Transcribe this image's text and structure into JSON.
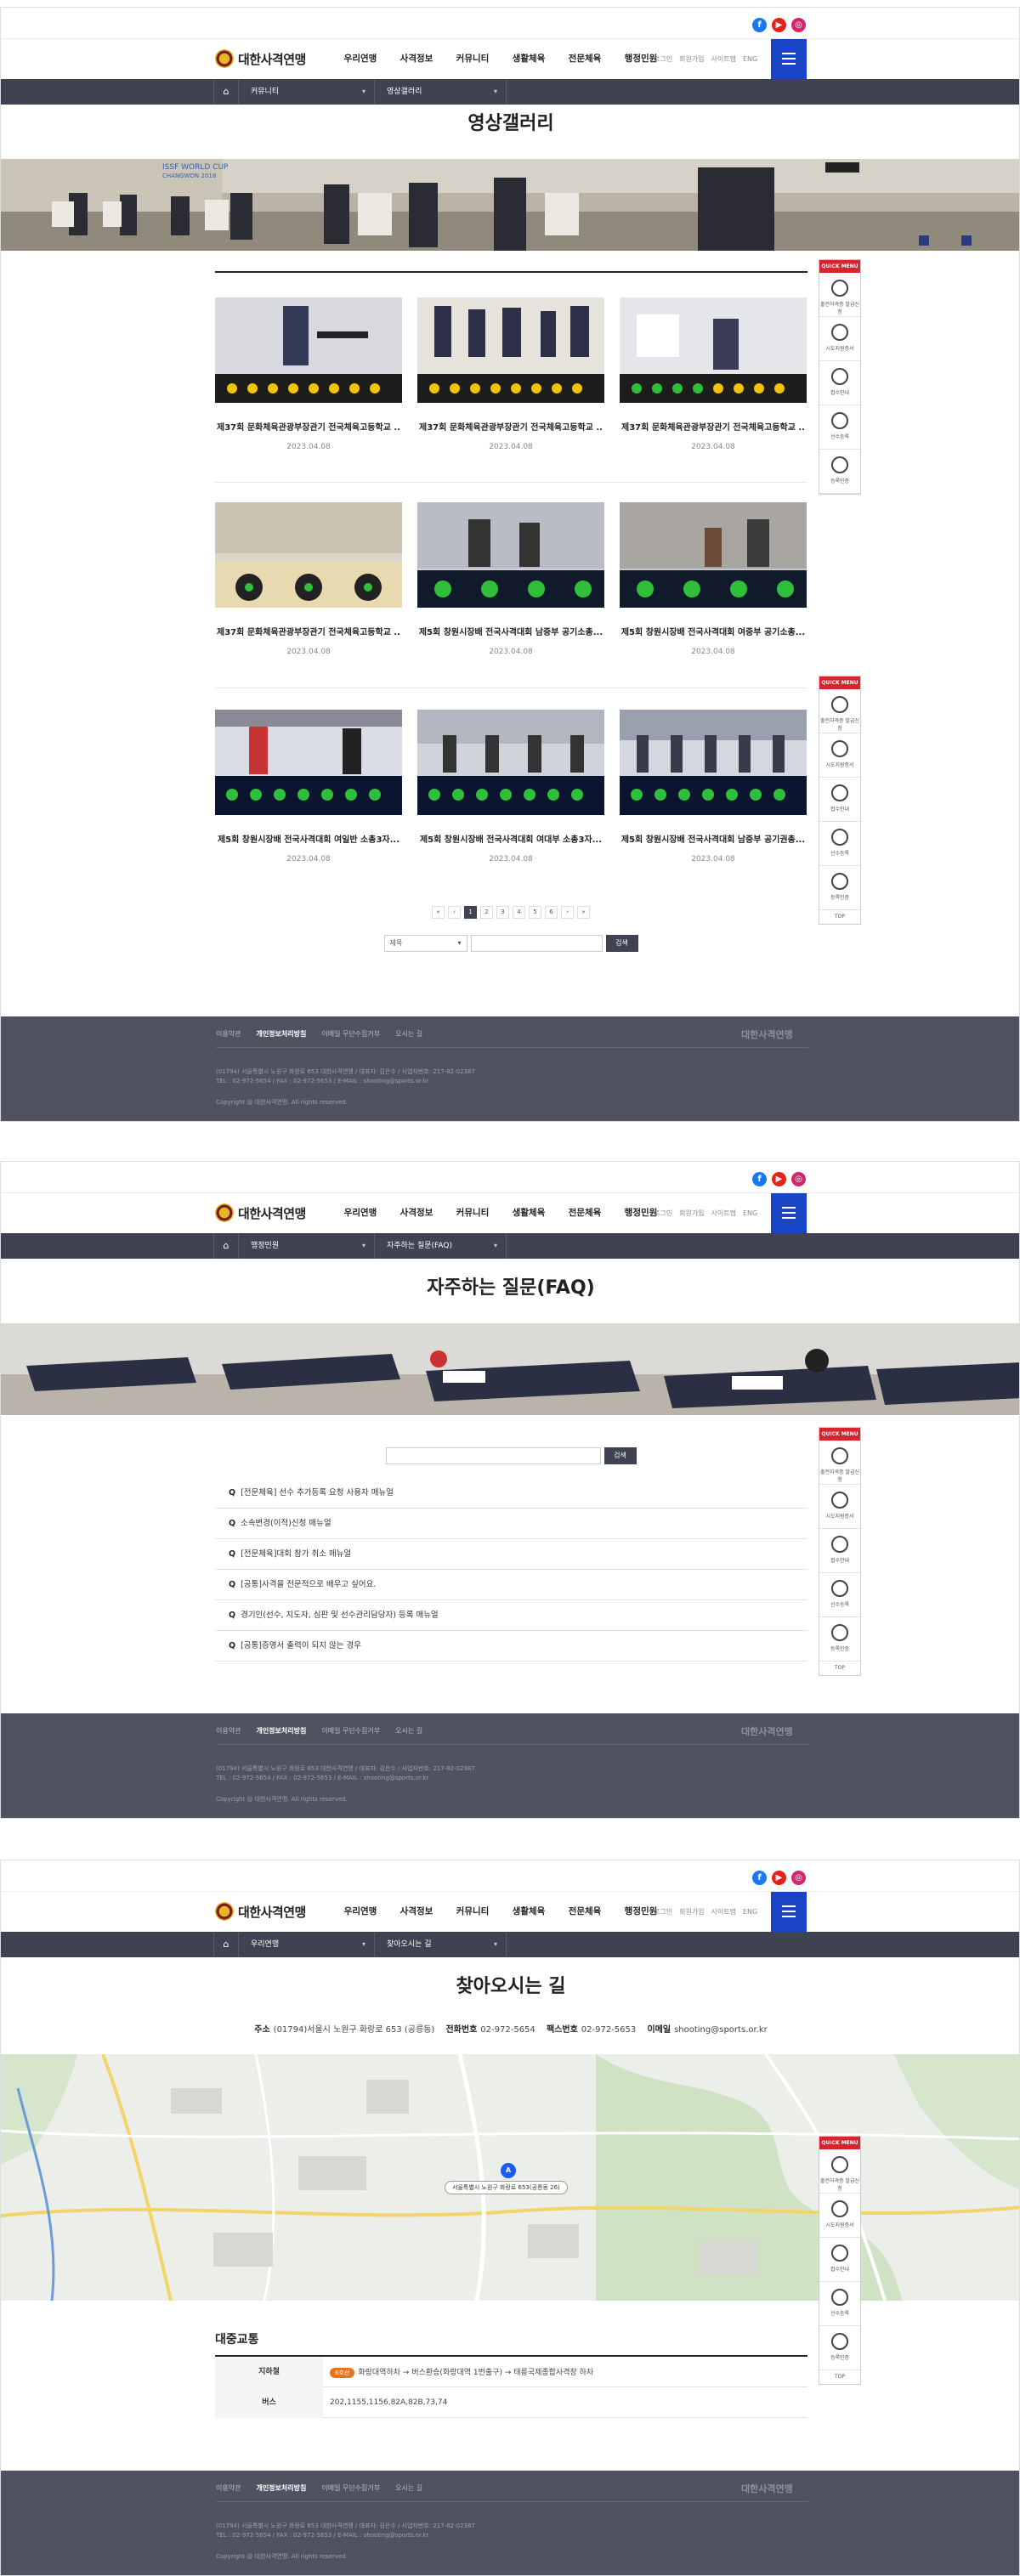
{
  "header": {
    "logo_text": "대한사격연맹",
    "sns": [
      "facebook-icon",
      "youtube-icon",
      "instagram-icon"
    ],
    "menu": [
      "우리연맹",
      "사격정보",
      "커뮤니티",
      "생활체육",
      "전문체육",
      "행정민원"
    ],
    "util": [
      "로그인",
      "회원가입",
      "사이트맵",
      "ENG"
    ]
  },
  "quick_menu": {
    "header": "QUICK MENU",
    "items": [
      "출전자격증 발급신청",
      "시도지원증서",
      "접수안내",
      "선수등록",
      "등록인증"
    ],
    "top": "TOP"
  },
  "gallery_page": {
    "lnb_depth1": "커뮤니티",
    "lnb_depth2": "영상갤러리",
    "title": "영상갤러리",
    "items": [
      {
        "title": "제37회 문화체육관광부장관기 전국체육고등학교 ..",
        "date": "2023.04.08"
      },
      {
        "title": "제37회 문화체육관광부장관기 전국체육고등학교 ..",
        "date": "2023.04.08"
      },
      {
        "title": "제37회 문화체육관광부장관기 전국체육고등학교 ..",
        "date": "2023.04.08"
      },
      {
        "title": "제37회 문화체육관광부장관기 전국체육고등학교 ..",
        "date": "2023.04.08"
      },
      {
        "title": "제5회 창원시장배 전국사격대회 남중부 공기소총...",
        "date": "2023.04.08"
      },
      {
        "title": "제5회 창원시장배 전국사격대회 여중부 공기소총...",
        "date": "2023.04.08"
      },
      {
        "title": "제5회 창원시장배 전국사격대회 여일반 소총3자...",
        "date": "2023.04.08"
      },
      {
        "title": "제5회 창원시장배 전국사격대회 여대부 소총3자...",
        "date": "2023.04.08"
      },
      {
        "title": "제5회 창원시장배 전국사격대회 남중부 공기권총...",
        "date": "2023.04.08"
      }
    ],
    "pager": [
      "«",
      "‹",
      "1",
      "2",
      "3",
      "4",
      "5",
      "6",
      "›",
      "»"
    ],
    "search_select": "제목",
    "search_button": "검색"
  },
  "faq_page": {
    "lnb_depth1": "행정민원",
    "lnb_depth2": "자주하는 질문(FAQ)",
    "title": "자주하는 질문(FAQ)",
    "search_button": "검색",
    "q_mark": "Q",
    "questions": [
      "[전문체육] 선수 추가등록 요청 사용자 매뉴얼",
      "소속변경(이적)신청 매뉴얼",
      "[전문체육]대회 참가 취소 매뉴얼",
      "[공통]사격을 전문적으로 배우고 싶어요.",
      "경기인(선수, 지도자, 심판 및 선수관리담당자) 등록 매뉴얼",
      "[공통]증명서 출력이 되지 않는 경우"
    ]
  },
  "location_page": {
    "lnb_depth1": "우리연맹",
    "lnb_depth2": "찾아오시는 길",
    "title": "찾아오시는 길",
    "address_label": "주소",
    "address": "(01794)서울시 노원구 화랑로 653 (공릉동)",
    "phone_label": "전화번호",
    "phone": "02-972-5654",
    "fax_label": "팩스번호",
    "fax": "02-972-5653",
    "email_label": "이메일",
    "email": "shooting@sports.or.kr",
    "map_pin": "A",
    "map_label": "서울특별시 노원구 화랑로 653(공릉동 26)",
    "transport_title": "대중교통",
    "rows": [
      {
        "label": "지하철",
        "badge": "6호선",
        "text": "화랑대역하차 → 버스환승(화랑대역 1번출구) → 태릉국제종합사격장 하차"
      },
      {
        "label": "버스",
        "badge": "",
        "text": "202,1155,1156,82A,82B,73,74"
      }
    ]
  },
  "footer": {
    "links": [
      "이용약관",
      "개인정보처리방침",
      "이메일 무단수집거부",
      "오시는 길"
    ],
    "logo": "대한사격연맹",
    "info1": "(01794) 서울특별시 노원구 화랑로 653 대한사격연맹 / 대표자: 김은수 / 사업자번호: 217-82-02387",
    "info2": "TEL : 02-972-5654 / FAX : 02-972-5653 / E-MAIL : shooting@sports.or.kr",
    "copyright": "Copyright @ 대한사격연맹. All rights reserved."
  },
  "colors": {
    "nav_dark": "#3e4251",
    "footer_bg": "#50535f",
    "accent_blue": "#1a44c6",
    "quick_red": "#d9232d",
    "subway_badge": "#e8731f"
  }
}
